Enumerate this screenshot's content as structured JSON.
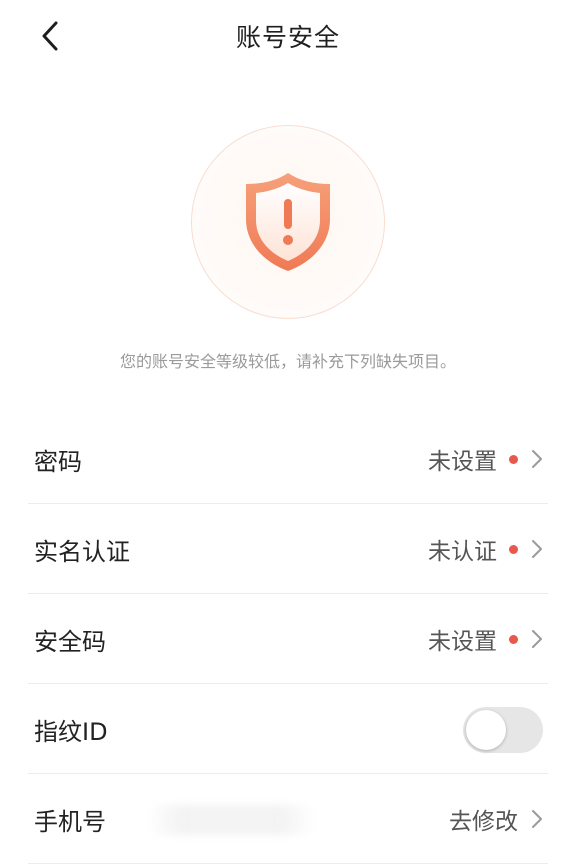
{
  "header": {
    "title": "账号安全",
    "back_icon": "chevron-left-icon"
  },
  "shield": {
    "icon": "shield-warning-icon",
    "accent_color": "#f1875e"
  },
  "notice": "您的账号安全等级较低，请补充下列缺失项目。",
  "items": [
    {
      "label": "密码",
      "status": "未设置",
      "has_dot": true
    },
    {
      "label": "实名认证",
      "status": "未认证",
      "has_dot": true
    },
    {
      "label": "安全码",
      "status": "未设置",
      "has_dot": true
    },
    {
      "label": "指纹ID",
      "toggle_on": false
    },
    {
      "label": "手机号",
      "status": "去修改",
      "has_dot": false
    }
  ],
  "colors": {
    "dot": "#e8584d",
    "toggle_off": "#e6e6e6"
  }
}
